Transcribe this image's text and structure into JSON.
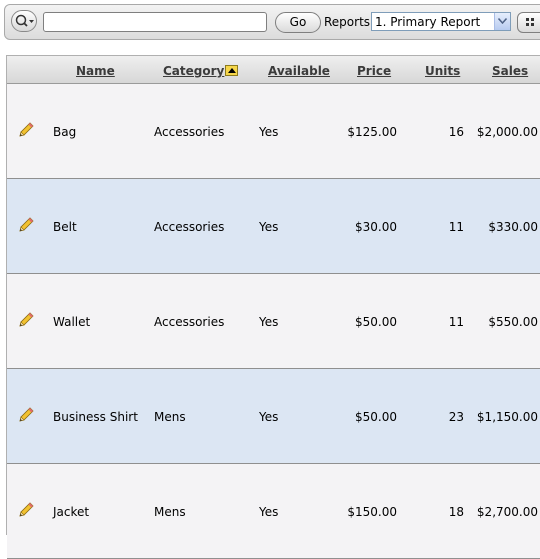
{
  "toolbar": {
    "search_value": "",
    "go_label": "Go",
    "reports_label": "Reports",
    "reports_selected": "1. Primary Report"
  },
  "table": {
    "columns": [
      {
        "key": "name",
        "label": "Name"
      },
      {
        "key": "category",
        "label": "Category",
        "sorted": "ascending"
      },
      {
        "key": "available",
        "label": "Available"
      },
      {
        "key": "price",
        "label": "Price"
      },
      {
        "key": "units",
        "label": "Units"
      },
      {
        "key": "sales",
        "label": "Sales"
      }
    ],
    "rows": [
      {
        "name": "Bag",
        "category": "Accessories",
        "available": "Yes",
        "price": "$125.00",
        "units": "16",
        "sales": "$2,000.00"
      },
      {
        "name": "Belt",
        "category": "Accessories",
        "available": "Yes",
        "price": "$30.00",
        "units": "11",
        "sales": "$330.00"
      },
      {
        "name": "Wallet",
        "category": "Accessories",
        "available": "Yes",
        "price": "$50.00",
        "units": "11",
        "sales": "$550.00"
      },
      {
        "name": "Business Shirt",
        "category": "Mens",
        "available": "Yes",
        "price": "$50.00",
        "units": "23",
        "sales": "$1,150.00"
      },
      {
        "name": "Jacket",
        "category": "Mens",
        "available": "Yes",
        "price": "$150.00",
        "units": "18",
        "sales": "$2,700.00"
      }
    ]
  },
  "icons": {
    "search": "magnifier-dropdown-icon",
    "edit": "pencil-icon",
    "sort": "sort-ascending-icon",
    "view": "grid-view-icon"
  },
  "colors": {
    "row_odd": "#f4f3f5",
    "row_even": "#dce6f3",
    "sort_badge": "#f6d64a"
  }
}
